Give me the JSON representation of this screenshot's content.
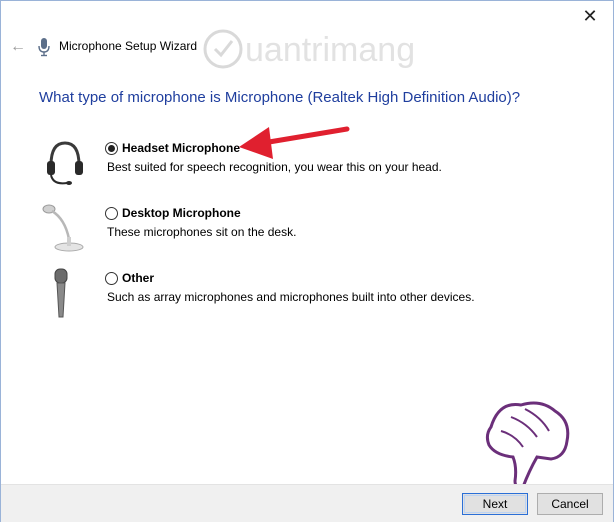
{
  "window": {
    "title": "Microphone Setup Wizard",
    "close_glyph": "✕",
    "back_glyph": "←"
  },
  "watermark": {
    "text": "uantrimang"
  },
  "question": "What type of microphone is Microphone (Realtek High Definition Audio)?",
  "options": [
    {
      "label": "Headset Microphone",
      "description": "Best suited for speech recognition, you wear this on your head.",
      "selected": true,
      "icon": "headset-icon"
    },
    {
      "label": "Desktop Microphone",
      "description": "These microphones sit on the desk.",
      "selected": false,
      "icon": "desktop-mic-icon"
    },
    {
      "label": "Other",
      "description": "Such as array microphones and microphones built into other devices.",
      "selected": false,
      "icon": "handheld-mic-icon"
    }
  ],
  "buttons": {
    "next": "Next",
    "cancel": "Cancel"
  },
  "colors": {
    "heading": "#1f3e9e",
    "arrow": "#e0202f",
    "hand_pointer": "#6b2f7a"
  }
}
